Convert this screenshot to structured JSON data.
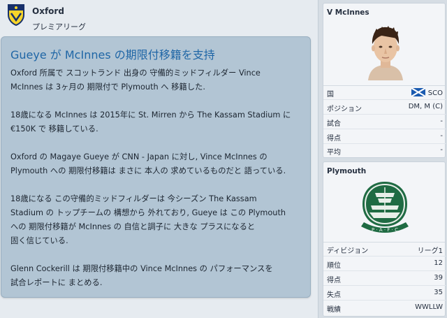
{
  "header": {
    "club_name": "Oxford",
    "league": "プレミアリーグ"
  },
  "news": {
    "title": "Gueye が McInnes の期限付移籍を支持",
    "paragraphs": [
      [
        "Oxford 所属で スコットランド 出身の 守備的ミッドフィルダー Vince",
        "McInnes は 3ヶ月の 期限付で Plymouth へ 移籍した."
      ],
      [
        "18歳になる McInnes は 2015年に St. Mirren から The Kassam Stadium に",
        "€150K で 移籍している."
      ],
      [
        "Oxford の Magaye Gueye が CNN - Japan に対し, Vince McInnes の",
        "Plymouth への 期限付移籍は まさに 本人の 求めているものだと 語っている."
      ],
      [
        "18歳になる この守備的ミッドフィルダーは 今シーズン The Kassam",
        "Stadium の トップチームの 構想から 外れており, Gueye は この Plymouth",
        "への 期限付移籍が McInnes の 自信と調子に 大きな プラスになると",
        "固く信じている."
      ],
      [
        "Glenn Cockerill は 期限付移籍中の Vince McInnes の パフォーマンスを",
        "試合レポートに まとめる."
      ]
    ]
  },
  "player": {
    "name": "V McInnes",
    "rows": [
      {
        "label": "国",
        "value": "SCO"
      },
      {
        "label": "ポジション",
        "value": "DM, M (C)"
      },
      {
        "label": "試合",
        "value": "-"
      },
      {
        "label": "得点",
        "value": "-"
      },
      {
        "label": "平均",
        "value": "-"
      }
    ]
  },
  "club": {
    "name": "Plymouth",
    "crest_text": "P · A · F · C",
    "rows": [
      {
        "label": "ディビジョン",
        "value": "リーグ1"
      },
      {
        "label": "順位",
        "value": "12"
      },
      {
        "label": "得点",
        "value": "39"
      },
      {
        "label": "失点",
        "value": "35"
      },
      {
        "label": "戦績",
        "value": "WWLLW"
      }
    ]
  }
}
